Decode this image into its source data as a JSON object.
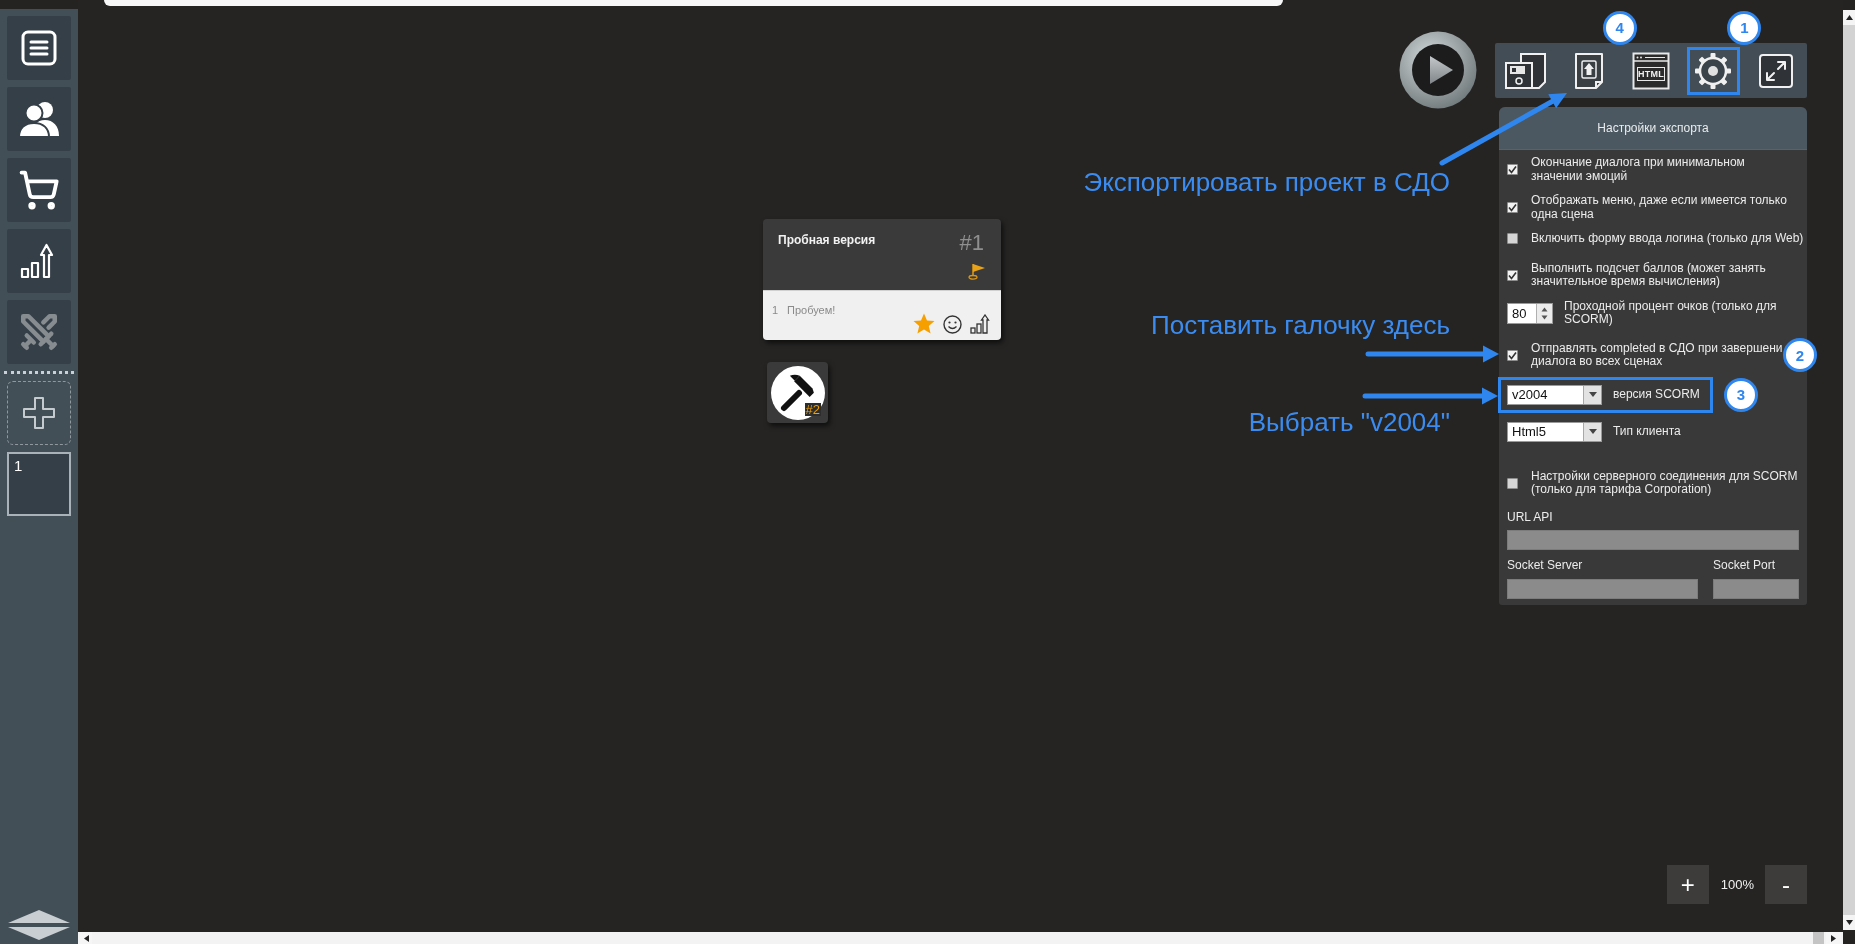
{
  "sidebar": {
    "tools": [
      {
        "disabled": false
      },
      {
        "disabled": false
      },
      {
        "disabled": false
      },
      {
        "disabled": false
      },
      {
        "disabled": true
      }
    ],
    "scenes": [
      {
        "label": "1",
        "selected": true
      }
    ]
  },
  "toolbar": {
    "buttons": [
      {
        "highlighted": false
      },
      {
        "highlighted": false,
        "badge": "4"
      },
      {
        "highlighted": false,
        "label": "HTML"
      },
      {
        "highlighted": true,
        "badge": "1"
      },
      {
        "highlighted": false
      }
    ]
  },
  "export_settings": {
    "title": "Настройки экспорта",
    "rows": [
      {
        "kind": "checkbox",
        "text": "Окончание диалога при минимальном\nзначении эмоций",
        "checked": true
      },
      {
        "kind": "checkbox",
        "text": "Отображать меню, даже если имеется только\nодна сцена",
        "checked": true
      },
      {
        "kind": "checkbox",
        "text": "Включить форму ввода логина (только для Web)",
        "checked": false
      },
      {
        "kind": "checkbox",
        "text": "Выполнить подсчет баллов (может занять\nзначительное время вычисления)",
        "checked": true
      },
      {
        "kind": "spinner",
        "value": "80",
        "text": "Проходной процент очков (только для\nSCORM)"
      },
      {
        "kind": "checkbox",
        "text": "Отправлять completed в СДО при завершени\nдиалога во всех сценах",
        "checked": true,
        "badge": "2"
      },
      {
        "kind": "select",
        "value": "v2004",
        "text": "версия SCORM",
        "highlighted": true,
        "badge": "3"
      },
      {
        "kind": "select",
        "value": "Html5",
        "text": "Тип клиента",
        "highlighted": false
      },
      {
        "kind": "checkbox",
        "text": "Настройки серверного соединения для SCORM\n(только для тарифа Corporation)",
        "checked": false
      }
    ],
    "fields": [
      {
        "label": "URL API",
        "disabled": true
      },
      {
        "label": "Socket Server",
        "disabled": true
      },
      {
        "label": "Socket Port",
        "disabled": true
      }
    ]
  },
  "canvas": {
    "nodes": [
      {
        "kind": "dialog",
        "title": "Пробная версия",
        "number": "#1",
        "lines": [
          {
            "index": "1",
            "text": "Пробуем!"
          }
        ]
      },
      {
        "kind": "action",
        "number": "#2"
      }
    ]
  },
  "annotations": [
    {
      "text": "Экспортировать проект в СДО"
    },
    {
      "text": "Поставить галочку здесь"
    },
    {
      "text": "Выбрать \"v2004\""
    }
  ],
  "zoom": {
    "zoom_in": "+",
    "value": "100%",
    "zoom_out": "-"
  }
}
